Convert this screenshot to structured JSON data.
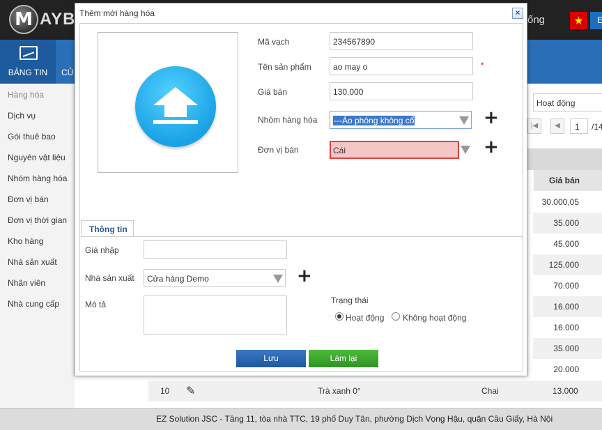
{
  "header": {
    "logo_letter": "M",
    "logo_text": "AYBA",
    "right_text": "ống",
    "lang_label": "E"
  },
  "nav": {
    "active_label": "BẢNG TIN",
    "second_label": "CỦ"
  },
  "sidebar": {
    "items": [
      {
        "label": "Hàng hóa"
      },
      {
        "label": "Dịch vụ"
      },
      {
        "label": "Gói thuê bao"
      },
      {
        "label": "Nguyên vật liệu"
      },
      {
        "label": "Nhóm hàng hóa"
      },
      {
        "label": "Đơn vị bán"
      },
      {
        "label": "Đơn vị thời gian"
      },
      {
        "label": "Kho hàng"
      },
      {
        "label": "Nhà sản xuất"
      },
      {
        "label": "Nhân viên"
      },
      {
        "label": "Nhà cung cấp"
      }
    ]
  },
  "background": {
    "status_filter": "Hoạt động",
    "pager": {
      "page": "1",
      "total": "/14"
    },
    "price_header": "Giá bán",
    "prices": [
      "30.000,05",
      "35.000",
      "45.000",
      "125.000",
      "70.000",
      "16.000",
      "16.000",
      "35.000",
      "20.000"
    ],
    "last_row": {
      "index": "10",
      "name": "Trà xanh 0°",
      "unit": "Chai",
      "price": "13.000"
    }
  },
  "footer": {
    "text": "EZ Solution JSC - Tầng 11, tòa nhà TTC, 19 phố Duy Tân, phường Dịch Vọng Hậu, quận Cầu Giấy, Hà Nội"
  },
  "modal": {
    "title": "Thêm mới hàng hóa",
    "close": "×",
    "fields": {
      "barcode_label": "Mã vạch",
      "barcode_value": "234567890",
      "name_label": "Tên sản phẩm",
      "name_value": "ao may o",
      "required_mark": "*",
      "price_label": "Giá bán",
      "price_value": "130.000",
      "group_label": "Nhóm hàng hóa",
      "group_value": "---Áo phông không cổ",
      "unit_label": "Đơn vị bán",
      "unit_value": "Cái"
    },
    "tab_label": "Thông tin",
    "info": {
      "import_price_label": "Giá nhập",
      "import_price_value": "",
      "manufacturer_label": "Nhà sản xuất",
      "manufacturer_value": "Cửa hàng Demo",
      "description_label": "Mô tả",
      "status_label": "Trạng thái",
      "status_active": "Hoạt động",
      "status_inactive": "Không hoạt động",
      "status_selected": "Hoạt động"
    },
    "buttons": {
      "save": "Lưu",
      "reset": "Làm lại"
    }
  },
  "colors": {
    "nav_blue": "#2a6eb8",
    "save_blue": "#2a67b3",
    "reset_green": "#3aa52c",
    "error_red": "#e04040"
  }
}
